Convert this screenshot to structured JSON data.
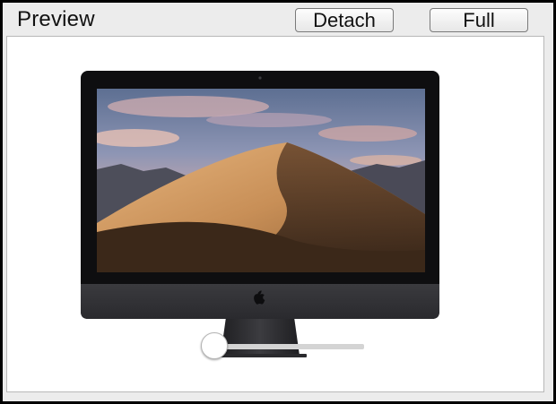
{
  "header": {
    "title": "Preview",
    "detach_label": "Detach",
    "full_label": "Full"
  },
  "preview": {
    "image": "imac-mojave-desktop",
    "icon": "apple-logo-icon"
  },
  "slider": {
    "value": 0
  }
}
